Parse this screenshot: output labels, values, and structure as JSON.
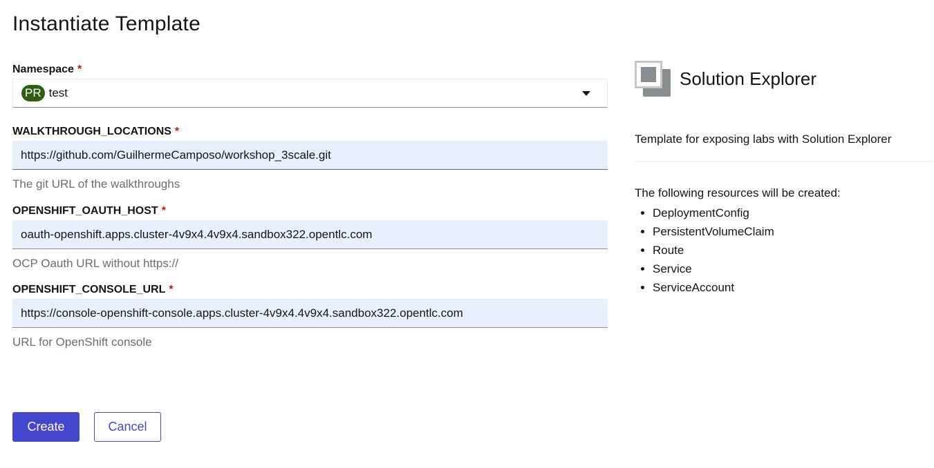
{
  "page": {
    "title": "Instantiate Template"
  },
  "form": {
    "namespace": {
      "label": "Namespace",
      "required_mark": "*",
      "badge": "PR",
      "value": "test"
    },
    "fields": [
      {
        "label": "WALKTHROUGH_LOCATIONS",
        "required_mark": "*",
        "value": "https://github.com/GuilhermeCamposo/workshop_3scale.git",
        "help": "The git URL of the walkthroughs"
      },
      {
        "label": "OPENSHIFT_OAUTH_HOST",
        "required_mark": "*",
        "value": "oauth-openshift.apps.cluster-4v9x4.4v9x4.sandbox322.opentlc.com",
        "help": "OCP Oauth URL without https://"
      },
      {
        "label": "OPENSHIFT_CONSOLE_URL",
        "required_mark": "*",
        "value": "https://console-openshift-console.apps.cluster-4v9x4.4v9x4.sandbox322.opentlc.com",
        "help": "URL for OpenShift console"
      }
    ],
    "actions": {
      "create_label": "Create",
      "cancel_label": "Cancel"
    }
  },
  "sidebar": {
    "title": "Solution Explorer",
    "icon": "template-icon",
    "description": "Template for exposing labs with Solution Explorer",
    "resources_intro": "The following resources will be created:",
    "resources": [
      "DeploymentConfig",
      "PersistentVolumeClaim",
      "Route",
      "Service",
      "ServiceAccount"
    ]
  },
  "colors": {
    "primary": "#4447cd",
    "required": "#c9190b",
    "badge_bg": "#2e5e0f",
    "autofill_bg": "#e8f0fe"
  }
}
